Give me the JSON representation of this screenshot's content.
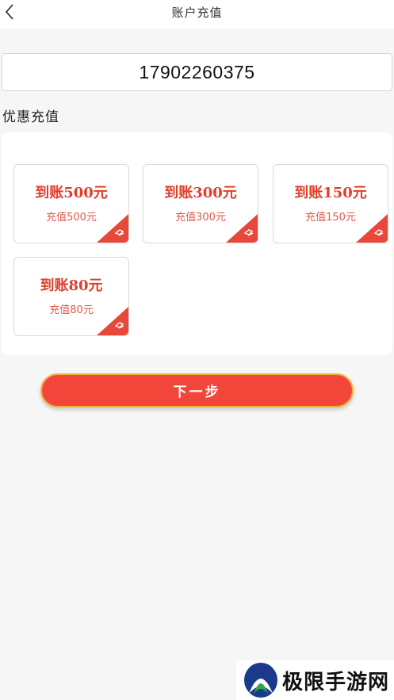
{
  "header": {
    "title": "账户充值",
    "back_icon": "chevron-left-icon"
  },
  "account": {
    "number": "17902260375"
  },
  "section": {
    "label": "优惠充值"
  },
  "options": [
    {
      "main": "到账500元",
      "sub": "充值500元"
    },
    {
      "main": "到账300元",
      "sub": "充值300元"
    },
    {
      "main": "到账150元",
      "sub": "充值150元"
    },
    {
      "main": "到账80元",
      "sub": "充值80元"
    }
  ],
  "next_button": {
    "label": "下一步"
  },
  "watermark": {
    "text": "极限手游网"
  },
  "colors": {
    "accent": "#f2463a",
    "button_border": "#f0b43a",
    "card_text": "#e03e2d"
  }
}
